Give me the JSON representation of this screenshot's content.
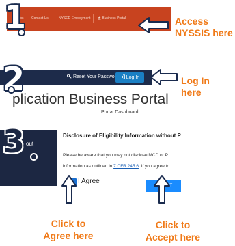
{
  "step1": {
    "number": "1",
    "nav_items": [
      "Jobs",
      "Contact Us",
      "NYSED Employment",
      "Business Portal"
    ],
    "callout_line1": "Access",
    "callout_line2": "NYSSIS here"
  },
  "step2": {
    "number": "2",
    "reset_label": "Reset Your Password",
    "login_label": "Log In",
    "callout_line1": "Log In",
    "callout_line2": "here",
    "portal_title": "plication Business Portal",
    "portal_subtitle": "Portal Dashboard"
  },
  "step3": {
    "number": "3",
    "sidebar_label": "out",
    "disclosure_title": "Disclosure of Eligibility Information without P",
    "disclosure_text1": "Please be aware that you may not disclose MCD or P",
    "disclosure_text2_prefix": "information as outlined in ",
    "disclosure_link": "7 CFR 245.6",
    "disclosure_text2_suffix": ". If you agree to",
    "agree_label": "I Agree",
    "accept_label": "ACCEPT",
    "hint_agree_line1": "Click to",
    "hint_agree_line2": "Agree here",
    "hint_accept_line1": "Click to",
    "hint_accept_line2": "Accept here"
  },
  "colors": {
    "nav_orange": "#c8431f",
    "navy": "#1d2b4a",
    "login_blue": "#1a7fc4",
    "callout_orange": "#f07a18",
    "accept_blue": "#1a8cff"
  },
  "icons": [
    "key-icon",
    "login-icon",
    "bank-icon",
    "arrow-left-icon",
    "arrow-up-icon"
  ]
}
